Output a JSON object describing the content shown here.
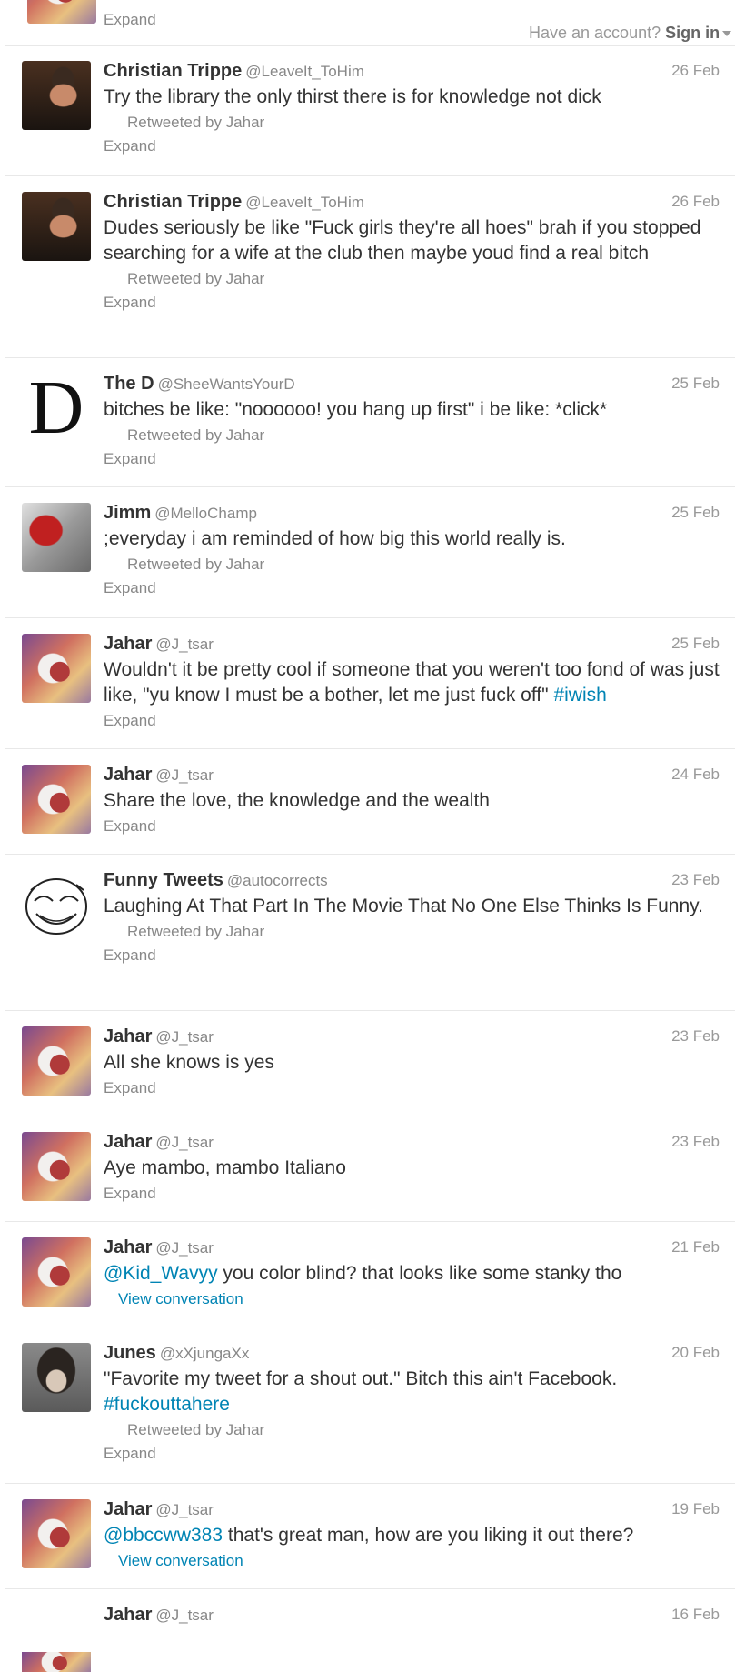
{
  "topbar": {
    "prompt": "Have an account?",
    "signin": "Sign in"
  },
  "top_expand": "Expand",
  "tweets": [
    {
      "name": "Christian Trippe",
      "handle": "@LeaveIt_ToHim",
      "time": "26 Feb",
      "text": "Try the library the only thirst there is for knowledge not dick",
      "retweeted": "Retweeted by Jahar",
      "action": "Expand"
    },
    {
      "name": "Christian Trippe",
      "handle": "@LeaveIt_ToHim",
      "time": "26 Feb",
      "text": "Dudes seriously be like \"Fuck girls they're all hoes\" brah if you stopped searching for a wife at the club then maybe youd find a real bitch",
      "retweeted": "Retweeted by Jahar",
      "action": "Expand"
    },
    {
      "name": "The D",
      "handle": "@SheeWantsYourD",
      "time": "25 Feb",
      "text": "bitches be like: \"noooooo! you hang up first\" i be like: *click*",
      "retweeted": "Retweeted by Jahar",
      "action": "Expand",
      "avatar_letter": "D"
    },
    {
      "name": "Jimm",
      "handle": "@MelloChamp",
      "time": "25 Feb",
      "text": ";everyday i am reminded of how big this world really is.",
      "retweeted": "Retweeted by Jahar",
      "action": "Expand"
    },
    {
      "name": "Jahar",
      "handle": "@J_tsar",
      "time": "25 Feb",
      "text": "Wouldn't it be pretty cool if someone that you weren't too fond of was just like, \"yu know I must be a bother, let me just fuck off\"",
      "hashtag": "#iwish",
      "action": "Expand"
    },
    {
      "name": "Jahar",
      "handle": "@J_tsar",
      "time": "24 Feb",
      "text": "Share the love, the knowledge and the wealth",
      "action": "Expand"
    },
    {
      "name": "Funny Tweets",
      "handle": "@autocorrects",
      "time": "23 Feb",
      "text": "Laughing At That Part In The Movie That No One Else Thinks Is Funny.",
      "retweeted": "Retweeted by Jahar",
      "action": "Expand"
    },
    {
      "name": "Jahar",
      "handle": "@J_tsar",
      "time": "23 Feb",
      "text": "All she knows is yes",
      "action": "Expand"
    },
    {
      "name": "Jahar",
      "handle": "@J_tsar",
      "time": "23 Feb",
      "text": "Aye mambo, mambo Italiano",
      "action": "Expand"
    },
    {
      "name": "Jahar",
      "handle": "@J_tsar",
      "time": "21 Feb",
      "mention": "@Kid_Wavyy",
      "text": " you color blind? that looks like some stanky tho",
      "action": "View conversation"
    },
    {
      "name": "Junes",
      "handle": "@xXjungaXx",
      "time": "20 Feb",
      "text": "\"Favorite my tweet for a shout out.\" Bitch this ain't Facebook.",
      "hashtag": "#fuckouttahere",
      "retweeted": "Retweeted by Jahar",
      "action": "Expand"
    },
    {
      "name": "Jahar",
      "handle": "@J_tsar",
      "time": "19 Feb",
      "mention": "@bbccww383",
      "text": " that's great man, how are you liking it out there?",
      "action": "View conversation"
    },
    {
      "name": "Jahar",
      "handle": "@J_tsar",
      "time": "16 Feb"
    }
  ]
}
